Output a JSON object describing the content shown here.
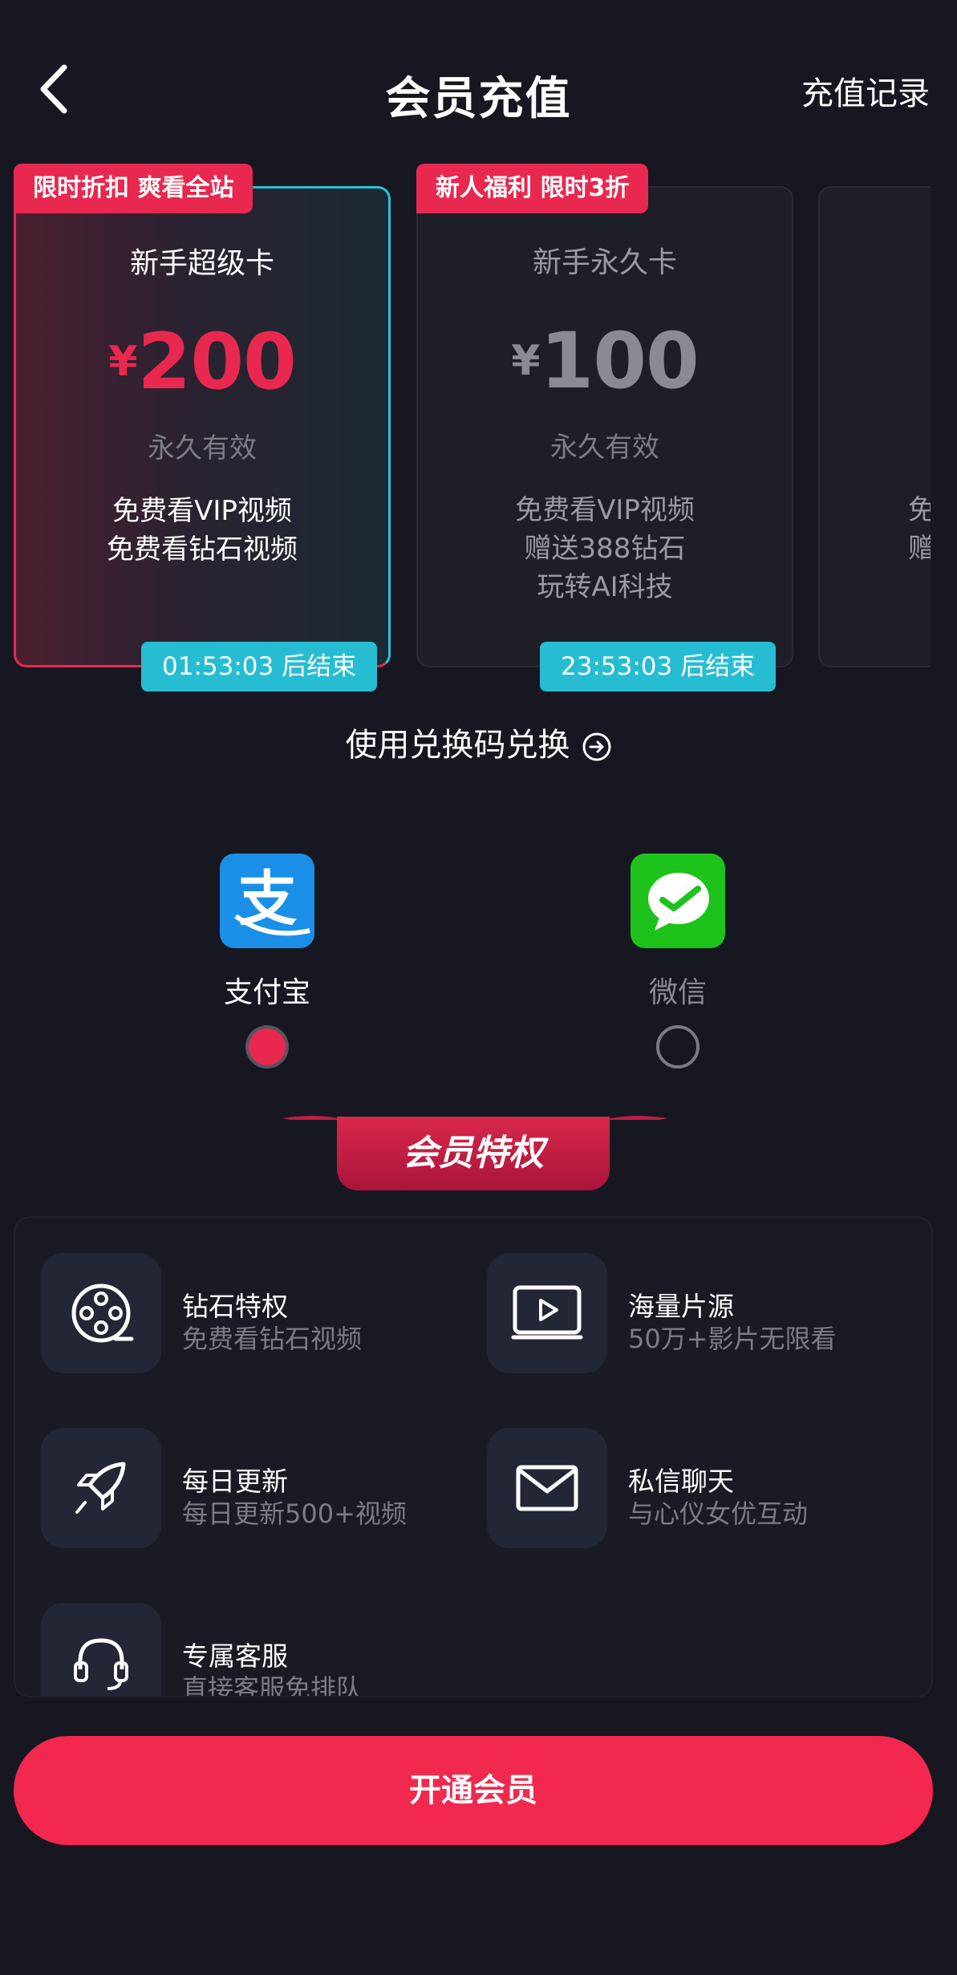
{
  "header": {
    "title": "会员充值",
    "records_link": "充值记录",
    "back_icon": "chevron-left-icon"
  },
  "cards": [
    {
      "badge": "限时折扣 爽看全站",
      "name": "新手超级卡",
      "currency": "¥",
      "price": "200",
      "validity": "永久有效",
      "features": [
        "免费看VIP视频",
        "免费看钻石视频"
      ],
      "timer": "01:53:03 后结束",
      "selected": true
    },
    {
      "badge": "新人福利 限时3折",
      "name": "新手永久卡",
      "currency": "¥",
      "price": "100",
      "validity": "永久有效",
      "features": [
        "免费看VIP视频",
        "赠送388钻石",
        "玩转AI科技"
      ],
      "timer": "23:53:03 后结束",
      "selected": false
    },
    {
      "partial_features": [
        "免",
        "赠"
      ]
    }
  ],
  "redeem": {
    "label": "使用兑换码兑换",
    "icon": "arrow-right-circle-icon"
  },
  "payment": {
    "methods": [
      {
        "name": "支付宝",
        "icon": "alipay-icon",
        "selected": true
      },
      {
        "name": "微信",
        "icon": "wechat-icon",
        "selected": false
      }
    ]
  },
  "section": {
    "title": "会员特权"
  },
  "perks": [
    {
      "title": "钻石特权",
      "subtitle": "免费看钻石视频",
      "icon": "film-reel-icon"
    },
    {
      "title": "海量片源",
      "subtitle": "50万+影片无限看",
      "icon": "video-play-icon"
    },
    {
      "title": "每日更新",
      "subtitle": "每日更新500+视频",
      "icon": "rocket-icon"
    },
    {
      "title": "私信聊天",
      "subtitle": "与心仪女优互动",
      "icon": "mail-icon"
    },
    {
      "title": "专属客服",
      "subtitle": "直接客服免排队",
      "icon": "headset-icon"
    }
  ],
  "cta": {
    "label": "开通会员"
  },
  "colors": {
    "background": "#171722",
    "accent": "#f2284e",
    "timer": "#26bdd3",
    "alipay": "#1a8fe8",
    "wechat": "#1dc31a"
  }
}
